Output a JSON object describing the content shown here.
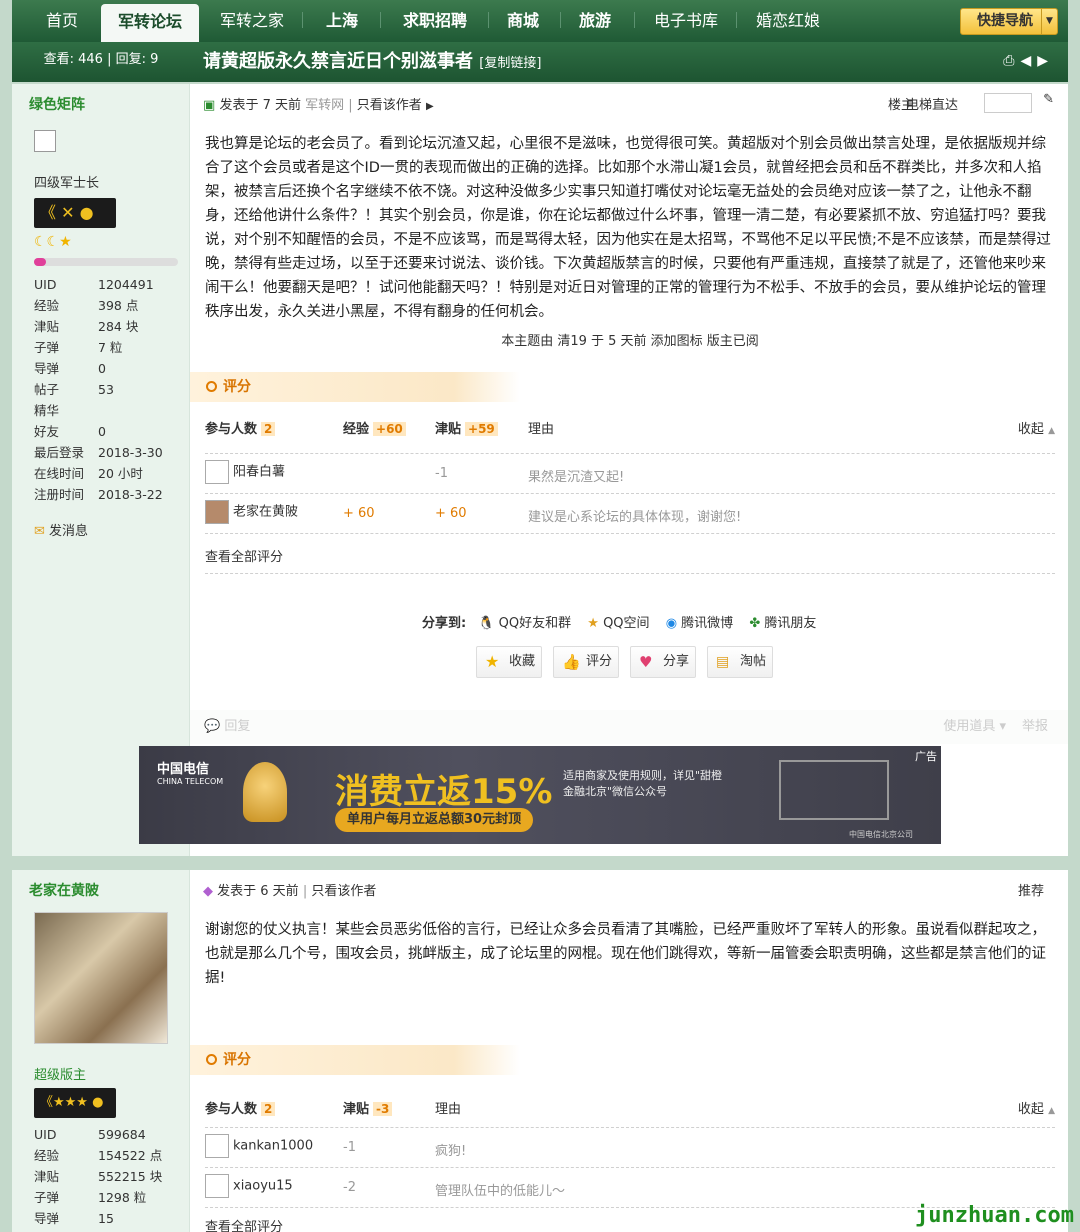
{
  "nav": {
    "items": [
      "首页",
      "军转论坛",
      "军转之家",
      "上海",
      "求职招聘",
      "商城",
      "旅游",
      "电子书库",
      "婚恋红娘"
    ],
    "quick": "快捷导航"
  },
  "thread": {
    "stats": "查看: 446 | 回复: 9",
    "title": "请黄超版永久禁言近日个别滋事者",
    "copy": "[复制链接]"
  },
  "post1": {
    "author": "绿色矩阵",
    "rank": "四级军士长",
    "info": [
      [
        "UID",
        "1204491"
      ],
      [
        "经验",
        "398 点"
      ],
      [
        "津贴",
        "284 块"
      ],
      [
        "子弹",
        "7 粒"
      ],
      [
        "导弹",
        "0"
      ],
      [
        "帖子",
        "53"
      ],
      [
        "精华",
        ""
      ],
      [
        "好友",
        "0"
      ],
      [
        "最后登录",
        "2018-3-30"
      ],
      [
        "在线时间",
        "20 小时"
      ],
      [
        "注册时间",
        "2018-3-22"
      ]
    ],
    "send_msg": "发消息",
    "posted": "发表于 7 天前",
    "via": "军转网",
    "only_author": "只看该作者",
    "floor": "楼主",
    "elevator": "电梯直达",
    "body": "我也算是论坛的老会员了。看到论坛沉渣又起，心里很不是滋味，也觉得很可笑。黄超版对个别会员做出禁言处理，是依据版规并综合了这个会员或者是这个ID一贯的表现而做出的正确的选择。比如那个水滞山凝1会员，就曾经把会员和岳不群类比，并多次和人掐架，被禁言后还换个名字继续不依不饶。对这种没做多少实事只知道打嘴仗对论坛毫无益处的会员绝对应该一禁了之，让他永不翻身，还给他讲什么条件？！其实个别会员，你是谁，你在论坛都做过什么坏事，管理一清二楚，有必要紧抓不放、穷追猛打吗？要我说，对个别不知醒悟的会员，不是不应该骂，而是骂得太轻，因为他实在是太招骂，不骂他不足以平民愤;不是不应该禁，而是禁得过晚，禁得有些走过场，以至于还要来讨说法、谈价钱。下次黄超版禁言的时候，只要他有严重违规，直接禁了就是了，还管他来吵来闹干么！他要翻天是吧？！试问他能翻天吗？！特别是对近日对管理的正常的管理行为不松手、不放手的会员，要从维护论坛的管理秩序出发，永久关进小黑屋，不得有翻身的任何机会。",
    "note": "本主题由 清19 于 5 天前 添加图标 版主已阅",
    "rate_title": "评分",
    "rate_head": {
      "count_label": "参与人数",
      "count": "2",
      "c1": "经验",
      "c1v": "+60",
      "c2": "津贴",
      "c2v": "+59",
      "reason": "理由",
      "collapse": "收起"
    },
    "rates": [
      {
        "user": "阳春白薯",
        "v1": "",
        "v2": "-1",
        "reason": "果然是沉渣又起!"
      },
      {
        "user": "老家在黄陂",
        "v1": "+ 60",
        "v2": "+ 60",
        "reason": "建议是心系论坛的具体体现，谢谢您!"
      }
    ],
    "view_all": "查看全部评分",
    "share_label": "分享到:",
    "share": [
      "QQ好友和群",
      "QQ空间",
      "腾讯微博",
      "腾讯朋友"
    ],
    "buttons": [
      "收藏",
      "评分",
      "分享",
      "淘帖"
    ],
    "reply": "回复",
    "tools": "使用道具",
    "report": "举报"
  },
  "ad": {
    "brand": "中国电信",
    "brand_en": "CHINA TELECOM",
    "headline": "消费立返15%",
    "sub": "单用户每月立返总额30元封顶",
    "rule": "适用商家及使用规则，详见\"甜橙金融北京\"微信公众号",
    "tag": "广告",
    "corp": "中国电信北京公司"
  },
  "post2": {
    "author": "老家在黄陂",
    "rank": "超级版主",
    "info": [
      [
        "UID",
        "599684"
      ],
      [
        "经验",
        "154522 点"
      ],
      [
        "津贴",
        "552215 块"
      ],
      [
        "子弹",
        "1298 粒"
      ],
      [
        "导弹",
        "15"
      ]
    ],
    "posted": "发表于 6 天前",
    "only_author": "只看该作者",
    "recommend": "推荐",
    "body": "谢谢您的仗义执言！某些会员恶劣低俗的言行，已经让众多会员看清了其嘴脸，已经严重败坏了军转人的形象。虽说看似群起攻之，也就是那么几个号，围攻会员，挑衅版主，成了论坛里的网棍。现在他们跳得欢，等新一届管委会职责明确，这些都是禁言他们的证据!",
    "rate_title": "评分",
    "rate_head": {
      "count_label": "参与人数",
      "count": "2",
      "c1": "津贴",
      "c1v": "-3",
      "reason": "理由",
      "collapse": "收起"
    },
    "rates": [
      {
        "user": "kankan1000",
        "v1": "-1",
        "reason": "疯狗!"
      },
      {
        "user": "xiaoyu15",
        "v1": "-2",
        "reason": "管理队伍中的低能儿〜"
      }
    ],
    "view_all": "查看全部评分"
  },
  "watermark": "junzhuan.com"
}
